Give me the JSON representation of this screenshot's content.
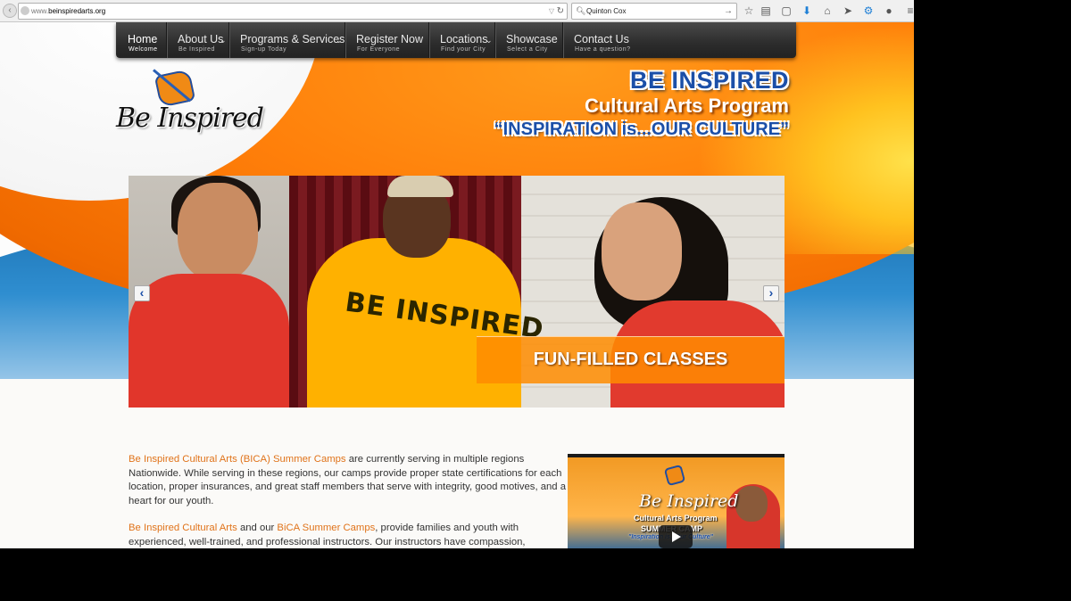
{
  "browser": {
    "url_prefix": "www.",
    "url_domain": "beinspiredarts.org",
    "search_value": "Quinton Cox"
  },
  "nav": {
    "items": [
      {
        "label": "Home",
        "sub": "Welcome",
        "active": true
      },
      {
        "label": "About Us",
        "sub": "Be Inspired",
        "dropdown": true
      },
      {
        "label": "Programs & Services",
        "sub": "Sign-up Today",
        "dropdown": true
      },
      {
        "label": "Register Now",
        "sub": "For Everyone"
      },
      {
        "label": "Locations",
        "sub": "Find your City",
        "dropdown": true
      },
      {
        "label": "Showcase",
        "sub": "Select a City"
      },
      {
        "label": "Contact Us",
        "sub": "Have a question?"
      }
    ]
  },
  "logo": {
    "wordmark": "Be Inspired"
  },
  "hero": {
    "line1": "BE INSPIRED",
    "line2": "Cultural Arts Program",
    "line3": "“INSPIRATION is...OUR CULTURE”"
  },
  "slider": {
    "caption": "FUN-FILLED CLASSES",
    "shirt_text": "BE INSPIRED",
    "prev": "‹",
    "next": "›"
  },
  "content": {
    "p1_highlight": "Be Inspired Cultural Arts (BICA) Summer Camps",
    "p1_text": " are currently serving in multiple regions Nationwide. While serving in these regions, our camps provide proper state certifications for each location, proper insurances, and great staff members that serve with integrity, good motives, and a heart for our youth.",
    "p2_highlight1": "Be Inspired Cultural Arts",
    "p2_mid": " and our ",
    "p2_highlight2": "BiCA Summer Camps",
    "p2_text": ", provide families and youth with experienced, well-trained, and professional instructors.  Our instructors have compassion, experience working with children (of all ages), and are well-knowledgeable of their curriculum and skill.  We serve and operate in excellence, and"
  },
  "video": {
    "title": "Be Inspired",
    "line2": "Cultural Arts Program",
    "line3": "SUMMER CAMP",
    "line4": "\"Inspiration is...Our Culture\""
  },
  "colors": {
    "accent_orange": "#e0731a",
    "brand_blue": "#1b4fa8",
    "nav_dark": "#2c2c2c"
  }
}
